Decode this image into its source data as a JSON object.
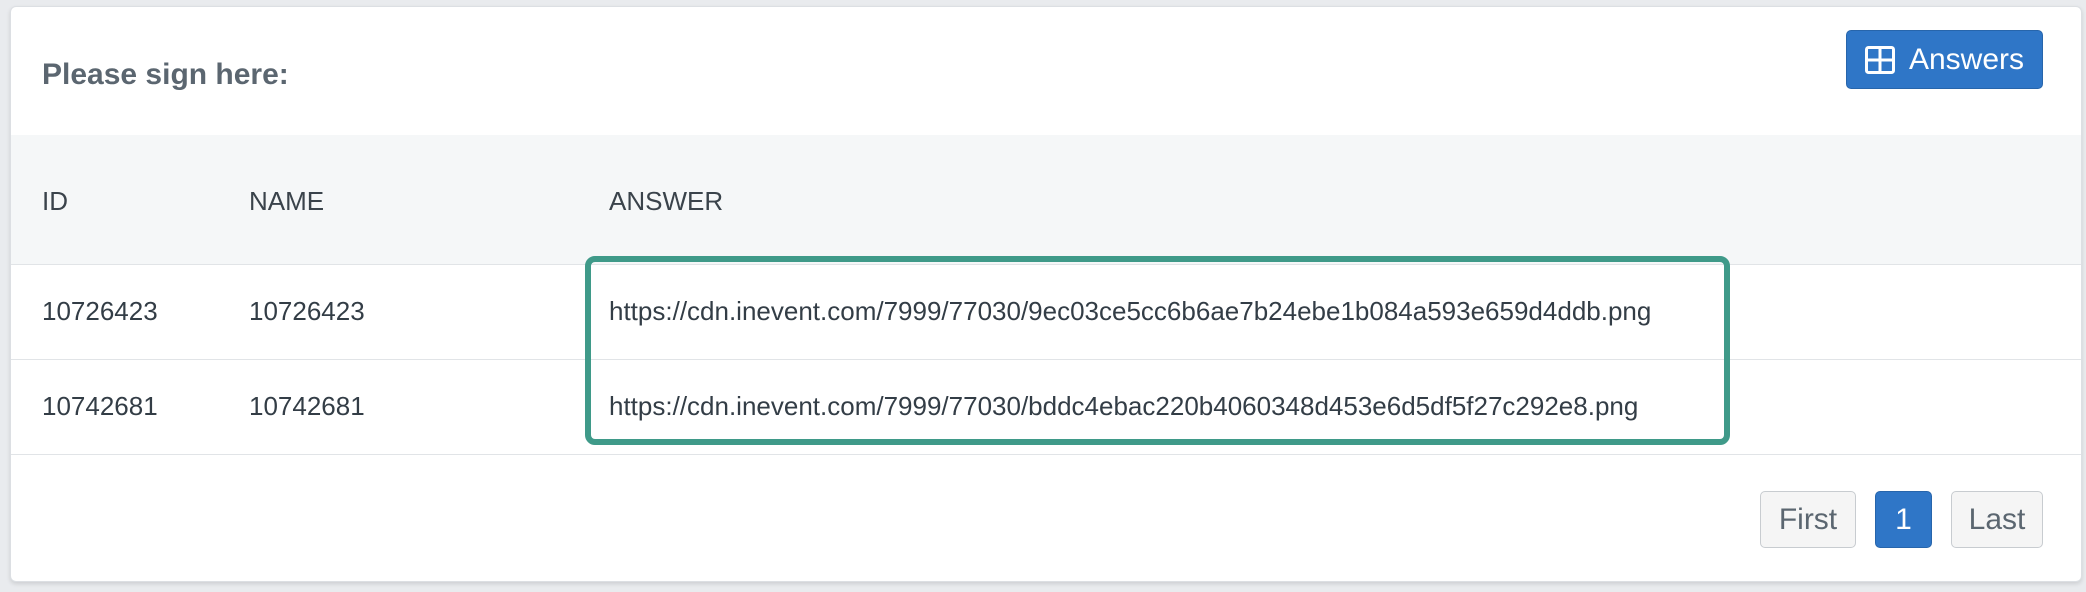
{
  "header": {
    "title": "Please sign here:",
    "answers_button": {
      "label": "Answers",
      "icon": "table-icon"
    }
  },
  "table": {
    "columns": [
      "ID",
      "NAME",
      "ANSWER"
    ],
    "rows": [
      {
        "id": "10726423",
        "name": "10726423",
        "answer": "https://cdn.inevent.com/7999/77030/9ec03ce5cc6b6ae7b24ebe1b084a593e659d4ddb.png"
      },
      {
        "id": "10742681",
        "name": "10742681",
        "answer": "https://cdn.inevent.com/7999/77030/bddc4ebac220b4060348d453e6d5df5f27c292e8.png"
      }
    ]
  },
  "pagination": {
    "first_label": "First",
    "current_page": "1",
    "last_label": "Last"
  },
  "colors": {
    "accent": "#2f76c7",
    "highlight_border": "#3f9a89"
  }
}
